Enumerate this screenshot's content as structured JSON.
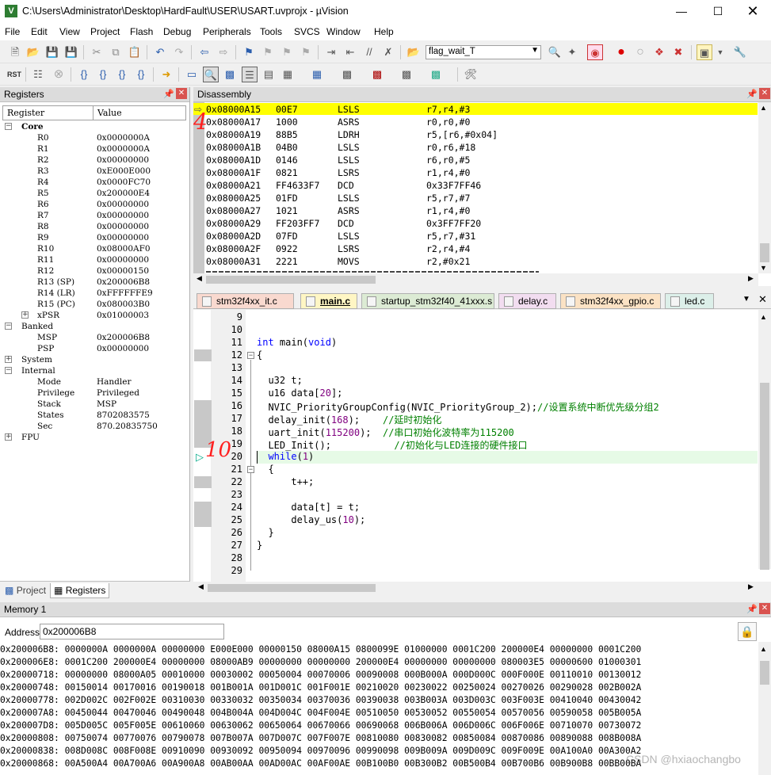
{
  "window": {
    "title": "C:\\Users\\Administrator\\Desktop\\HardFault\\USER\\USART.uvprojx - µVision"
  },
  "menu": [
    "File",
    "Edit",
    "View",
    "Project",
    "Flash",
    "Debug",
    "Peripherals",
    "Tools",
    "SVCS",
    "Window",
    "Help"
  ],
  "toolbar": {
    "target_combo": "flag_wait_T",
    "rst_label": "RST"
  },
  "registers": {
    "panel_title": "Registers",
    "col_register": "Register",
    "col_value": "Value",
    "groups": [
      {
        "label": "Core",
        "expanded": true,
        "items": [
          {
            "name": "R0",
            "value": "0x0000000A"
          },
          {
            "name": "R1",
            "value": "0x0000000A"
          },
          {
            "name": "R2",
            "value": "0x00000000"
          },
          {
            "name": "R3",
            "value": "0xE000E000"
          },
          {
            "name": "R4",
            "value": "0x0000FC70"
          },
          {
            "name": "R5",
            "value": "0x200000E4"
          },
          {
            "name": "R6",
            "value": "0x00000000"
          },
          {
            "name": "R7",
            "value": "0x00000000"
          },
          {
            "name": "R8",
            "value": "0x00000000"
          },
          {
            "name": "R9",
            "value": "0x00000000"
          },
          {
            "name": "R10",
            "value": "0x08000AF0"
          },
          {
            "name": "R11",
            "value": "0x00000000"
          },
          {
            "name": "R12",
            "value": "0x00000150"
          },
          {
            "name": "R13 (SP)",
            "value": "0x200006B8"
          },
          {
            "name": "R14 (LR)",
            "value": "0xFFFFFFE9"
          },
          {
            "name": "R15 (PC)",
            "value": "0x080003B0"
          },
          {
            "name": "xPSR",
            "value": "0x01000003",
            "collapsed": true
          }
        ]
      },
      {
        "label": "Banked",
        "expanded": true,
        "items": [
          {
            "name": "MSP",
            "value": "0x200006B8"
          },
          {
            "name": "PSP",
            "value": "0x00000000"
          }
        ]
      },
      {
        "label": "System",
        "expanded": false,
        "items": []
      },
      {
        "label": "Internal",
        "expanded": true,
        "items": [
          {
            "name": "Mode",
            "value": "Handler"
          },
          {
            "name": "Privilege",
            "value": "Privileged"
          },
          {
            "name": "Stack",
            "value": "MSP"
          },
          {
            "name": "States",
            "value": "8702083575"
          },
          {
            "name": "Sec",
            "value": "870.20835750"
          }
        ]
      },
      {
        "label": "FPU",
        "expanded": false,
        "items": []
      }
    ],
    "tabs": [
      "Project",
      "Registers"
    ]
  },
  "disassembly": {
    "panel_title": "Disassembly",
    "rows": [
      {
        "addr": "0x08000A15",
        "code": "00E7",
        "mnem": "LSLS",
        "ops": "r7,r4,#3",
        "current": true
      },
      {
        "addr": "0x08000A17",
        "code": "1000",
        "mnem": "ASRS",
        "ops": "r0,r0,#0"
      },
      {
        "addr": "0x08000A19",
        "code": "88B5",
        "mnem": "LDRH",
        "ops": "r5,[r6,#0x04]"
      },
      {
        "addr": "0x08000A1B",
        "code": "04B0",
        "mnem": "LSLS",
        "ops": "r0,r6,#18"
      },
      {
        "addr": "0x08000A1D",
        "code": "0146",
        "mnem": "LSLS",
        "ops": "r6,r0,#5"
      },
      {
        "addr": "0x08000A1F",
        "code": "0821",
        "mnem": "LSRS",
        "ops": "r1,r4,#0"
      },
      {
        "addr": "0x08000A21",
        "code": "FF4633F7",
        "mnem": "DCD",
        "ops": "0x33F7FF46"
      },
      {
        "addr": "0x08000A25",
        "code": "01FD",
        "mnem": "LSLS",
        "ops": "r5,r7,#7"
      },
      {
        "addr": "0x08000A27",
        "code": "1021",
        "mnem": "ASRS",
        "ops": "r1,r4,#0"
      },
      {
        "addr": "0x08000A29",
        "code": "FF203FF7",
        "mnem": "DCD",
        "ops": "0x3FF7FF20"
      },
      {
        "addr": "0x08000A2D",
        "code": "07FD",
        "mnem": "LSLS",
        "ops": "r5,r7,#31"
      },
      {
        "addr": "0x08000A2F",
        "code": "0922",
        "mnem": "LSRS",
        "ops": "r2,r4,#4"
      },
      {
        "addr": "0x08000A31",
        "code": "2221",
        "mnem": "MOVS",
        "ops": "r2,#0x21"
      }
    ]
  },
  "editor": {
    "tabs": [
      {
        "label": "stm32f4xx_it.c",
        "active": false,
        "color": "#f9d9cf"
      },
      {
        "label": "main.c",
        "active": true,
        "color": "#fff6c4"
      },
      {
        "label": "startup_stm32f40_41xxx.s",
        "active": false,
        "color": "#dcebd4"
      },
      {
        "label": "delay.c",
        "active": false,
        "color": "#f2ddf0"
      },
      {
        "label": "stm32f4xx_gpio.c",
        "active": false,
        "color": "#fbe2c4"
      },
      {
        "label": "led.c",
        "active": false,
        "color": "#dcefe9"
      }
    ],
    "line_numbers": [
      "9",
      "10",
      "11",
      "12",
      "13",
      "14",
      "15",
      "16",
      "17",
      "18",
      "19",
      "20",
      "21",
      "22",
      "23",
      "24",
      "25",
      "26",
      "27",
      "28",
      "29"
    ],
    "lines": {
      "l11_kw": "int",
      "l11_rest": " main(",
      "l11_kw2": "void",
      "l11_end": ")",
      "l12": "{",
      "l14": "  u32 t;",
      "l15a": "  u16 data[",
      "l15n": "20",
      "l15b": "];",
      "l16a": "  NVIC_PriorityGroupConfig(NVIC_PriorityGroup_2);",
      "l16c": "//设置系统中断优先级分组2",
      "l17a": "  delay_init(",
      "l17n": "168",
      "l17b": ");    ",
      "l17c": "//延时初始化",
      "l18a": "  uart_init(",
      "l18n": "115200",
      "l18b": ");  ",
      "l18c": "//串口初始化波特率为115200",
      "l19a": "  LED_Init();           ",
      "l19c": "//初始化与LED连接的硬件接口",
      "l20kw": "  while",
      "l20a": "(",
      "l20n": "1",
      "l20b": ")",
      "l21": "  {",
      "l22": "      t++;",
      "l24": "      data[t] = t;",
      "l25a": "      delay_us(",
      "l25n": "10",
      "l25b": ");",
      "l26": "  }",
      "l27": "}"
    }
  },
  "memory": {
    "panel_title": "Memory 1",
    "address_label": "Address:",
    "address_value": "0x200006B8",
    "rows": [
      "0x200006B8: 0000000A 0000000A 00000000 E000E000 00000150 08000A15 0800099E 01000000 0001C200 200000E4 00000000 0001C200",
      "0x200006E8: 0001C200 200000E4 00000000 08000AB9 00000000 00000000 200000E4 00000000 00000000 080003E5 00000600 01000301",
      "0x20000718: 00000000 08000A05 00010000 00030002 00050004 00070006 00090008 000B000A 000D000C 000F000E 00110010 00130012",
      "0x20000748: 00150014 00170016 00190018 001B001A 001D001C 001F001E 00210020 00230022 00250024 00270026 00290028 002B002A",
      "0x20000778: 002D002C 002F002E 00310030 00330032 00350034 00370036 00390038 003B003A 003D003C 003F003E 00410040 00430042",
      "0x200007A8: 00450044 00470046 00490048 004B004A 004D004C 004F004E 00510050 00530052 00550054 00570056 00590058 005B005A",
      "0x200007D8: 005D005C 005F005E 00610060 00630062 00650064 00670066 00690068 006B006A 006D006C 006F006E 00710070 00730072",
      "0x20000808: 00750074 00770076 00790078 007B007A 007D007C 007F007E 00810080 00830082 00850084 00870086 00890088 008B008A",
      "0x20000838: 008D008C 008F008E 00910090 00930092 00950094 00970096 00990098 009B009A 009D009C 009F009E 00A100A0 00A300A2",
      "0x20000868: 00A500A4 00A700A6 00A900A8 00AB00AA 00AD00AC 00AF00AE 00B100B0 00B300B2 00B500B4 00B700B6 00B900B8 00BB00BA"
    ]
  },
  "annotations": {
    "disasm_mark": "4",
    "editor_mark": "10"
  },
  "watermark": "CSDN @hxiaochangbo"
}
